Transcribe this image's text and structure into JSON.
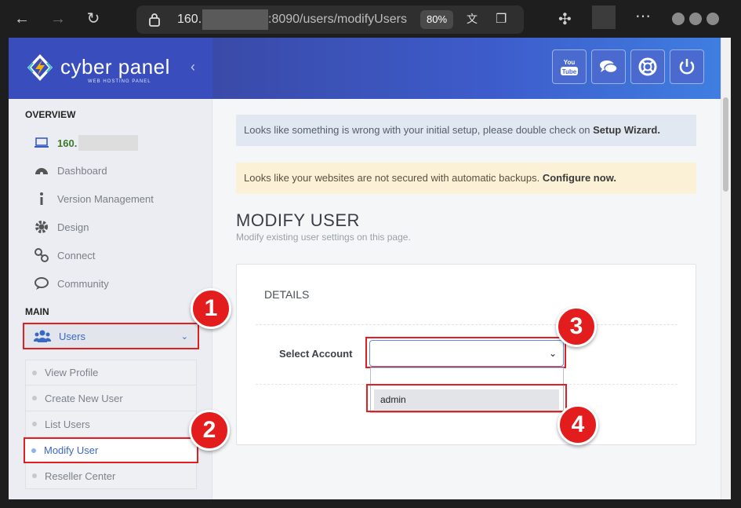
{
  "browser": {
    "url_prefix": "160.",
    "url_rest": ":8090/users/modifyUsers",
    "zoom": "80%"
  },
  "brand": {
    "name": "cyber panel",
    "tagline": "WEB HOSTING PANEL",
    "accent": "#3a4dbd"
  },
  "sidebar": {
    "overview_label": "OVERVIEW",
    "server_ip": "160.",
    "items": [
      {
        "label": "Dashboard",
        "icon": "dashboard-icon"
      },
      {
        "label": "Version Management",
        "icon": "info-icon"
      },
      {
        "label": "Design",
        "icon": "gear-icon"
      },
      {
        "label": "Connect",
        "icon": "link-icon"
      },
      {
        "label": "Community",
        "icon": "chat-icon"
      }
    ],
    "main_label": "MAIN",
    "users_label": "Users",
    "submenu": [
      {
        "label": "View Profile"
      },
      {
        "label": "Create New User"
      },
      {
        "label": "List Users"
      },
      {
        "label": "Modify User",
        "active": true
      },
      {
        "label": "Reseller Center"
      }
    ]
  },
  "header_buttons": [
    "youtube-icon",
    "chat-icon",
    "lifebuoy-icon",
    "power-icon"
  ],
  "alerts": {
    "setup_text": "Looks like something is wrong with your initial setup, please double check on ",
    "setup_link": "Setup Wizard.",
    "backup_text": "Looks like your websites are not secured with automatic backups. ",
    "backup_link": "Configure now."
  },
  "page": {
    "title": "MODIFY USER",
    "subtitle": "Modify existing user settings on this page."
  },
  "card": {
    "title": "DETAILS",
    "field_label": "Select Account",
    "selected_value": "",
    "options": [
      "admin"
    ]
  },
  "steps": [
    "1",
    "2",
    "3",
    "4"
  ]
}
